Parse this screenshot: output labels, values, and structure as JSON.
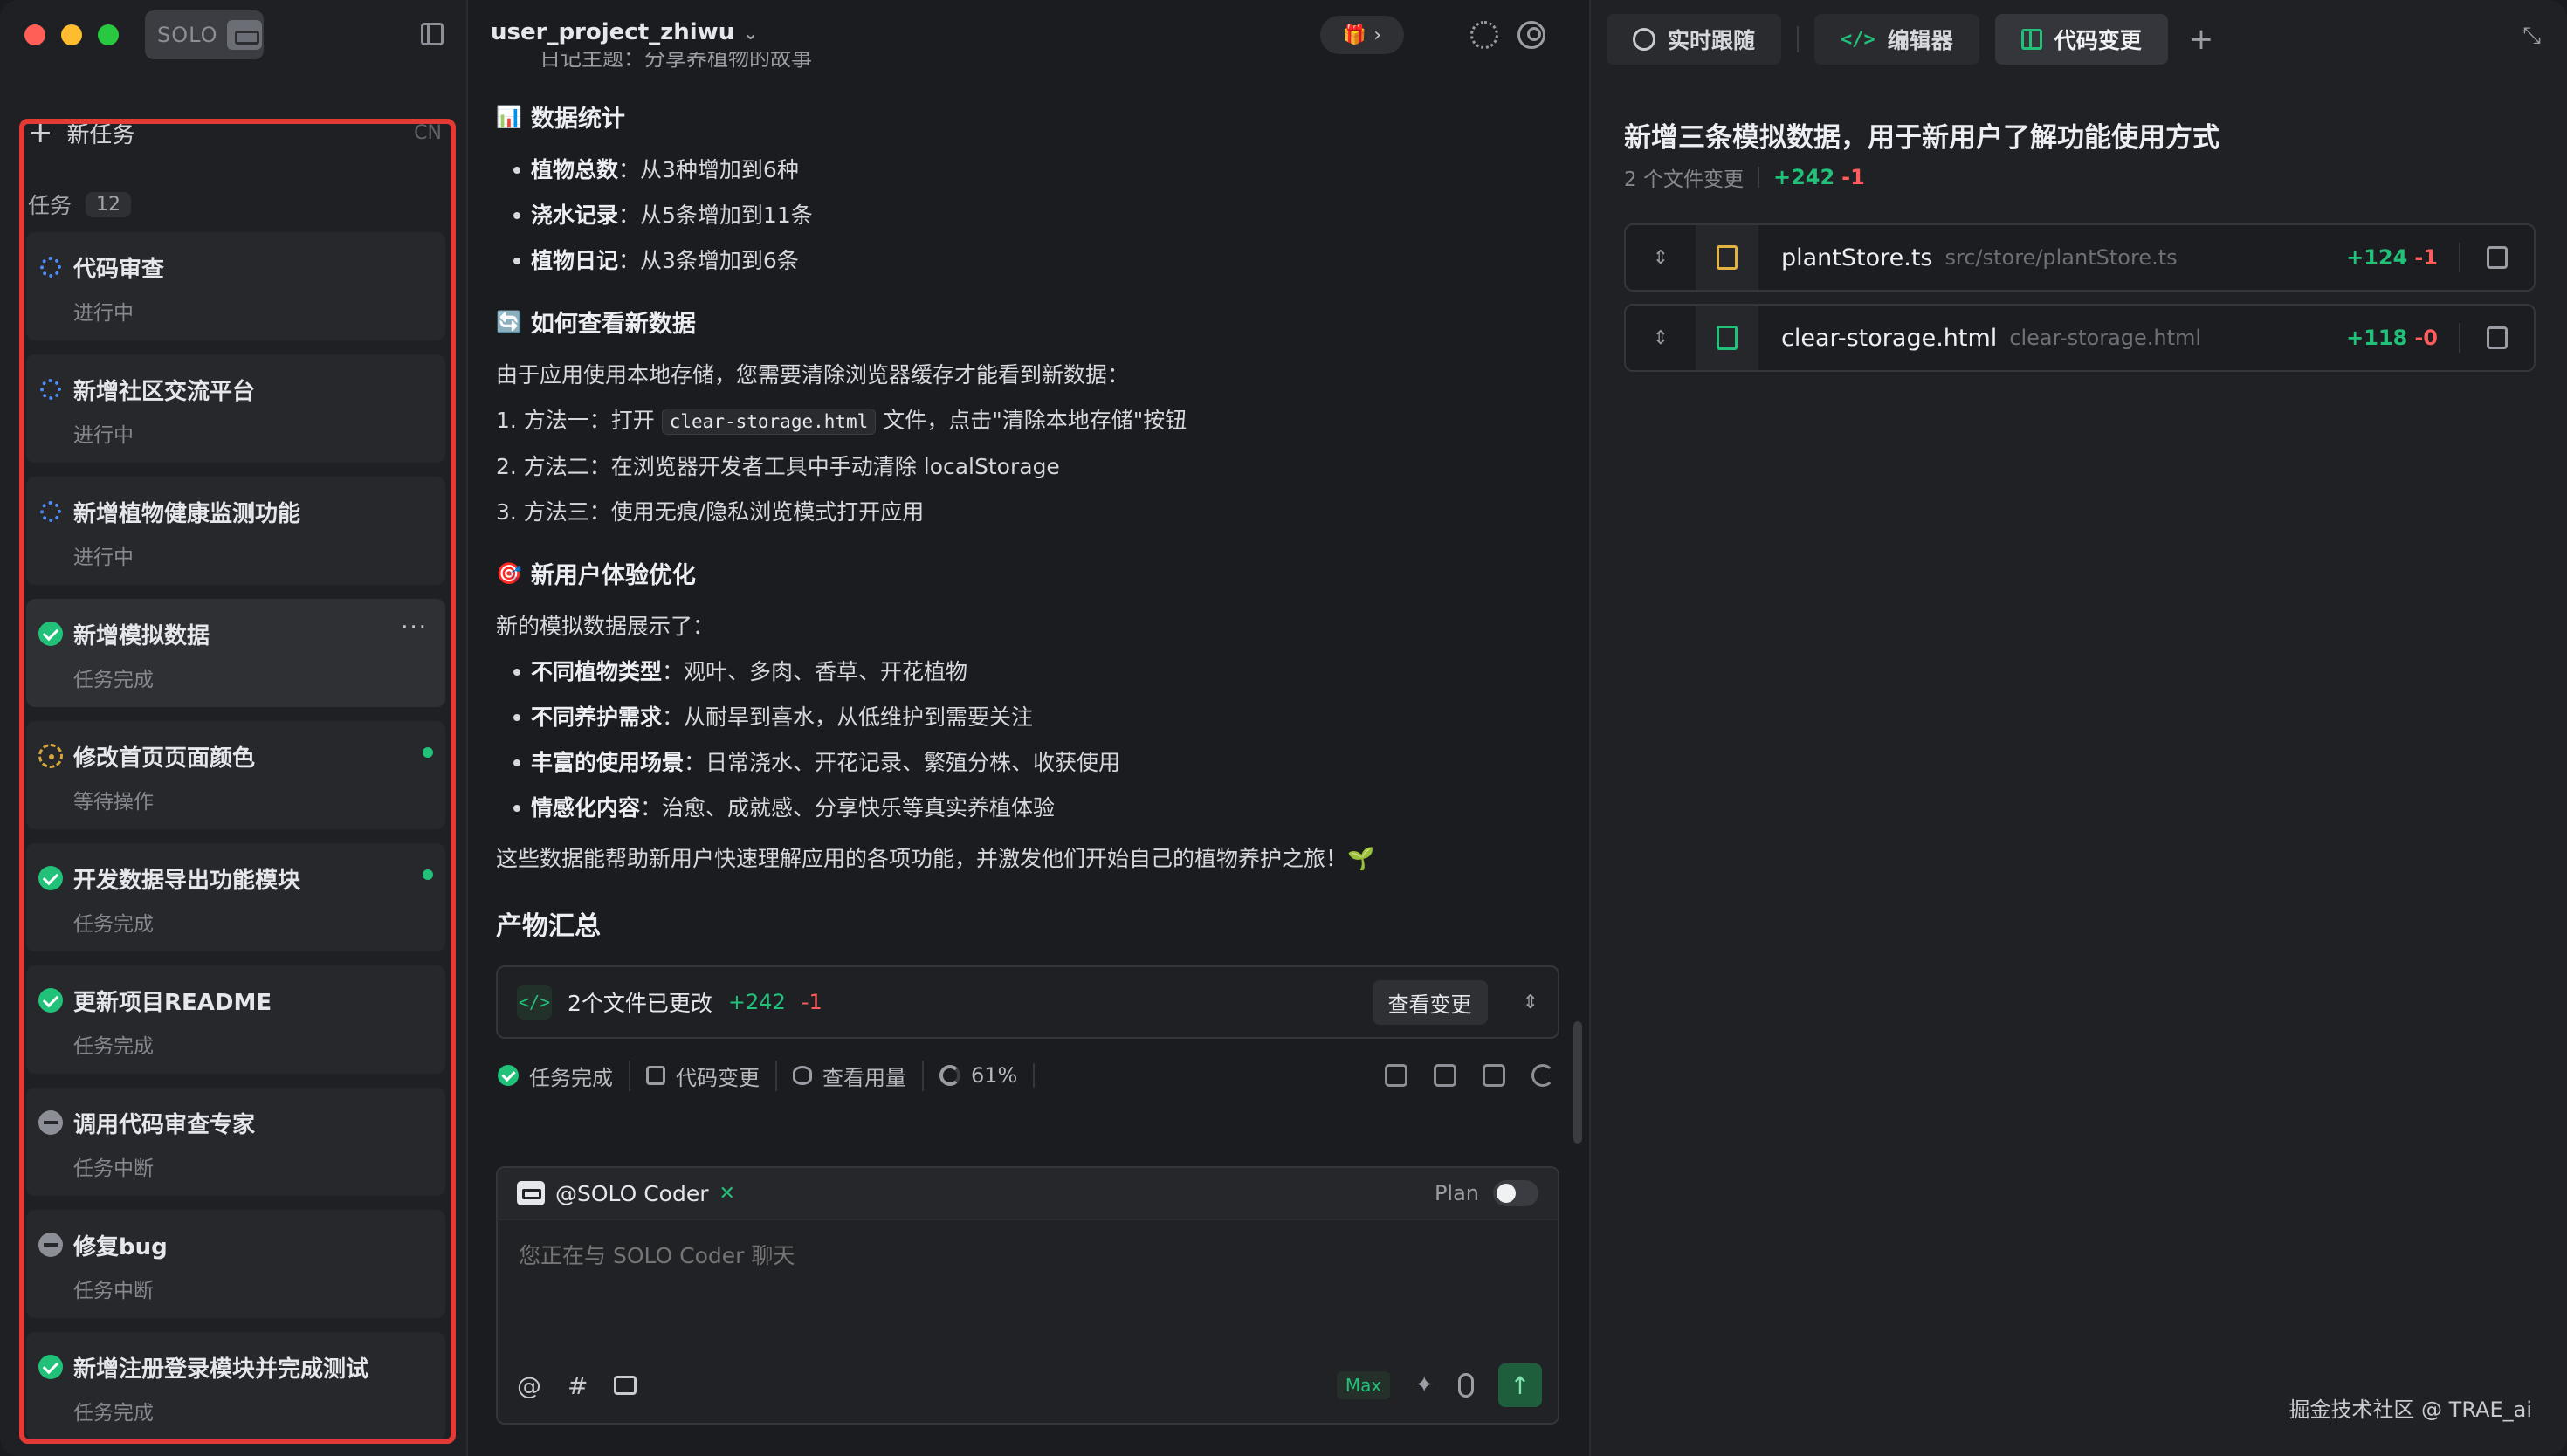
{
  "sidebar": {
    "solo_label": "SOLO",
    "new_task_label": "新任务",
    "lang_label": "CN",
    "tasks_label": "任务",
    "tasks_count": "12",
    "tasks": [
      {
        "title": "代码审查",
        "status": "进行中",
        "state": "progress"
      },
      {
        "title": "新增社区交流平台",
        "status": "进行中",
        "state": "progress"
      },
      {
        "title": "新增植物健康监测功能",
        "status": "进行中",
        "state": "progress"
      },
      {
        "title": "新增模拟数据",
        "status": "任务完成",
        "state": "done",
        "active": true
      },
      {
        "title": "修改首页页面颜色",
        "status": "等待操作",
        "state": "wait",
        "dot": true
      },
      {
        "title": "开发数据导出功能模块",
        "status": "任务完成",
        "state": "done",
        "dot": true
      },
      {
        "title": "更新项目README",
        "status": "任务完成",
        "state": "done"
      },
      {
        "title": "调用代码审查专家",
        "status": "任务中断",
        "state": "stop"
      },
      {
        "title": "修复bug",
        "status": "任务中断",
        "state": "stop"
      },
      {
        "title": "新增注册登录模块并完成测试",
        "status": "任务完成",
        "state": "done"
      }
    ],
    "more_label": "···"
  },
  "chat": {
    "project_name": "user_project_zhiwu",
    "clipped_line": "日记主题：分享养植物的故事",
    "stats_heading": "数据统计",
    "stats": [
      {
        "label": "植物总数",
        "text": "：从3种增加到6种"
      },
      {
        "label": "浇水记录",
        "text": "：从5条增加到11条"
      },
      {
        "label": "植物日记",
        "text": "：从3条增加到6条"
      }
    ],
    "howto_heading": "如何查看新数据",
    "howto_intro": "由于应用使用本地存储，您需要清除浏览器缓存才能看到新数据：",
    "step1_pre": "1. 方法一：打开 ",
    "step1_code": "clear-storage.html",
    "step1_post": " 文件，点击\"清除本地存储\"按钮",
    "step2": "2. 方法二：在浏览器开发者工具中手动清除 localStorage",
    "step3": "3. 方法三：使用无痕/隐私浏览模式打开应用",
    "ux_heading": "新用户体验优化",
    "ux_intro": "新的模拟数据展示了：",
    "ux_items": [
      {
        "label": "不同植物类型",
        "text": "：观叶、多肉、香草、开花植物"
      },
      {
        "label": "不同养护需求",
        "text": "：从耐旱到喜水，从低维护到需要关注"
      },
      {
        "label": "丰富的使用场景",
        "text": "：日常浇水、开花记录、繁殖分株、收获使用"
      },
      {
        "label": "情感化内容",
        "text": "：治愈、成就感、分享快乐等真实养植体验"
      }
    ],
    "closing": "这些数据能帮助新用户快速理解应用的各项功能，并激发他们开始自己的植物养护之旅！🌱",
    "product_heading": "产物汇总",
    "files_changed_label": "2个文件已更改",
    "files_plus": "+242",
    "files_minus": "-1",
    "view_changes_label": "查看变更",
    "status_done": "任务完成",
    "status_code_changes": "代码变更",
    "status_usage": "查看用量",
    "status_percent": "61%",
    "composer_agent": "@SOLO Coder",
    "plan_label": "Plan",
    "composer_placeholder": "您正在与 SOLO Coder 聊天",
    "max_label": "Max"
  },
  "panel": {
    "tabs": [
      {
        "label": "实时跟随"
      },
      {
        "label": "编辑器"
      },
      {
        "label": "代码变更"
      }
    ],
    "title": "新增三条模拟数据，用于新用户了解功能使用方式",
    "files_count_label": "2 个文件变更",
    "total_plus": "+242",
    "total_minus": "-1",
    "files": [
      {
        "name": "plantStore.ts",
        "path": "src/store/plantStore.ts",
        "plus": "+124",
        "minus": "-1",
        "type": "ts"
      },
      {
        "name": "clear-storage.html",
        "path": "clear-storage.html",
        "plus": "+118",
        "minus": "-0",
        "type": "html"
      }
    ],
    "watermark": "掘金技术社区 @ TRAE_ai"
  },
  "colors": {
    "accent_green": "#22c17a",
    "minus_red": "#ff5d5d",
    "highlight_frame": "#e53935",
    "in_progress_blue": "#4f8bf7",
    "waiting_amber": "#d7a536"
  },
  "icons": {
    "tab_follow": "crosshair-icon",
    "tab_editor": "code-icon",
    "tab_changes": "diff-grid-icon"
  }
}
